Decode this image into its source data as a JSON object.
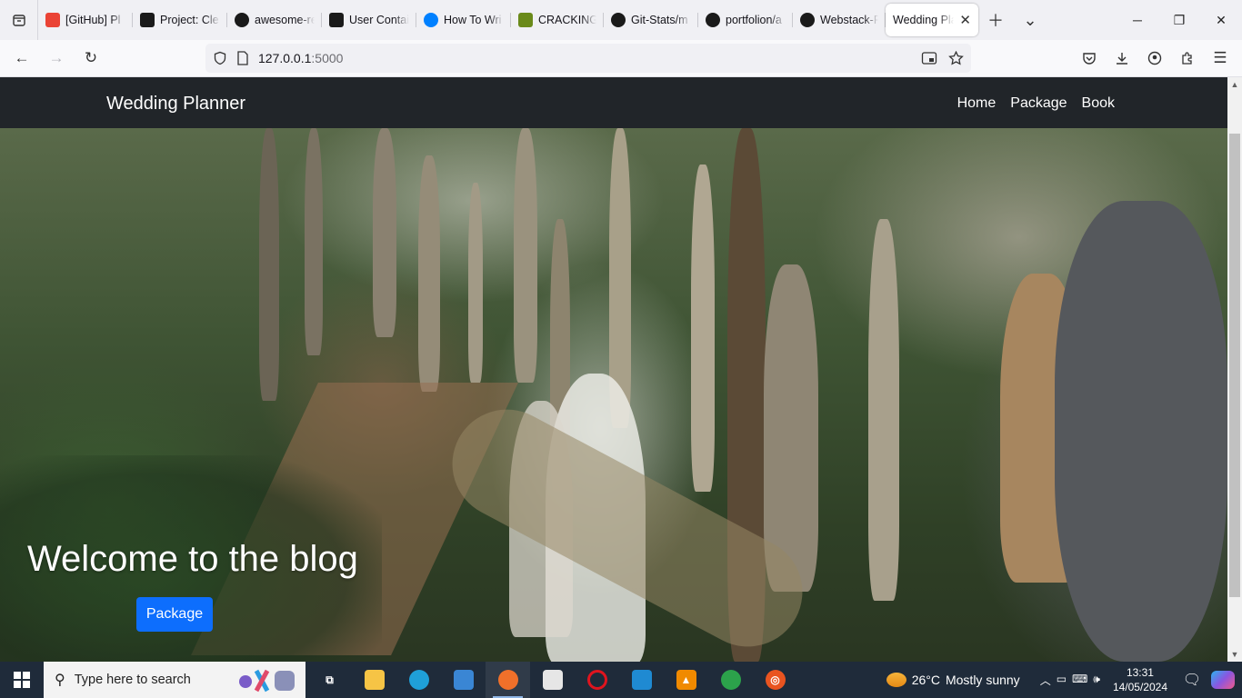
{
  "browser": {
    "tabs": [
      {
        "title": "[GitHub] Pl",
        "favicon": "gmail-icon",
        "color": "#ea4335"
      },
      {
        "title": "Project: Cle",
        "favicon": "alx-icon",
        "color": "#1a1a1a"
      },
      {
        "title": "awesome-re",
        "favicon": "github-icon",
        "color": "#1a1a1a"
      },
      {
        "title": "User Contai",
        "favicon": "alx-icon",
        "color": "#1a1a1a"
      },
      {
        "title": "How To Wri",
        "favicon": "digitalocean-icon",
        "color": "#0080ff"
      },
      {
        "title": "CRACKING",
        "favicon": "book-icon",
        "color": "#6a8a1a"
      },
      {
        "title": "Git-Stats/m",
        "favicon": "github-icon",
        "color": "#1a1a1a"
      },
      {
        "title": "portfolion/a",
        "favicon": "github-icon",
        "color": "#1a1a1a"
      },
      {
        "title": "Webstack-P",
        "favicon": "github-icon",
        "color": "#1a1a1a"
      },
      {
        "title": "Wedding Pla",
        "favicon": "none",
        "color": "#ffffff",
        "active": true
      }
    ],
    "url_host": "127.0.0.1",
    "url_port": ":5000"
  },
  "site": {
    "brand": "Wedding Planner",
    "nav_links": [
      "Home",
      "Package",
      "Book"
    ],
    "hero_title": "Welcome to the blog",
    "hero_button": "Package",
    "accent_color": "#0d6efd",
    "navbar_color": "#212529"
  },
  "taskbar": {
    "search_placeholder": "Type here to search",
    "pinned_apps": [
      {
        "name": "task-view-icon",
        "label": "⧉",
        "color": "transparent"
      },
      {
        "name": "file-explorer-icon",
        "label": "",
        "color": "#f6c445"
      },
      {
        "name": "edge-icon",
        "label": "",
        "color": "#1fa0d8"
      },
      {
        "name": "mail-icon",
        "label": "",
        "color": "#3a86d4"
      },
      {
        "name": "firefox-icon",
        "label": "",
        "color": "#f0702a",
        "active": true
      },
      {
        "name": "store-icon",
        "label": "",
        "color": "#e6e6e6"
      },
      {
        "name": "opera-icon",
        "label": "O",
        "color": "#e0141e"
      },
      {
        "name": "vscode-icon",
        "label": "",
        "color": "#1f8ad2"
      },
      {
        "name": "vlc-icon",
        "label": "▲",
        "color": "#f08a00"
      },
      {
        "name": "chrome-icon",
        "label": "",
        "color": "#2ca24b"
      },
      {
        "name": "ubuntu-icon",
        "label": "◎",
        "color": "#e95420"
      }
    ],
    "weather_temp": "26°C",
    "weather_text": "Mostly sunny",
    "time": "13:31",
    "date": "14/05/2024"
  }
}
